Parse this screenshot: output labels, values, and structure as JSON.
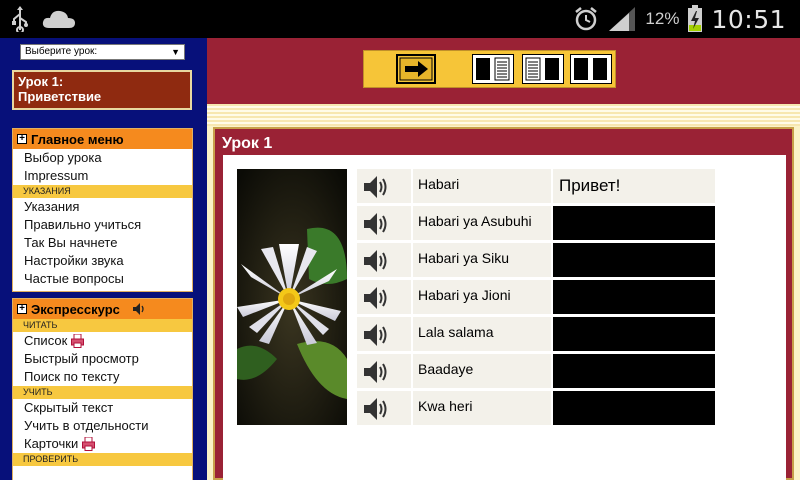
{
  "status_bar": {
    "battery_percent": "12%",
    "time": "10:51",
    "icons": [
      "usb-icon",
      "cloud-icon",
      "alarm-icon",
      "signal-icon",
      "battery-charging-icon"
    ]
  },
  "sidebar": {
    "lesson_select": {
      "value": "Выберите урок:"
    },
    "current_lesson": {
      "line1": "Урок 1:",
      "line2": "Приветствие"
    },
    "main_menu": {
      "title": "Главное меню",
      "items": [
        "Выбор урока",
        "Impressum"
      ],
      "section": "УКАЗАНИЯ",
      "section_items": [
        "Указания",
        "Правильно учиться",
        "Так Вы начнете",
        "Настройки звука",
        "Частые вопросы"
      ]
    },
    "express": {
      "title": "Экспресскурс",
      "read_section": "ЧИТАТЬ",
      "read_items": [
        "Список",
        "Быстрый просмотр",
        "Поиск по тексту"
      ],
      "learn_section": "УЧИТЬ",
      "learn_items": [
        "Скрытый текст",
        "Учить в отдельности",
        "Карточки"
      ],
      "check_section": "ПРОВЕРИТЬ"
    }
  },
  "toolbar": {
    "buttons": [
      "next-arrow-button",
      "layout-text-right-button",
      "layout-text-left-button",
      "layout-two-column-button"
    ]
  },
  "lesson": {
    "title": "Урок 1",
    "phrases": [
      {
        "text": "Habari",
        "translation": "Привет!",
        "revealed": true
      },
      {
        "text": "Habari ya Asubuhi",
        "translation": "",
        "revealed": false
      },
      {
        "text": "Habari ya Siku",
        "translation": "",
        "revealed": false
      },
      {
        "text": "Habari ya Jioni",
        "translation": "",
        "revealed": false
      },
      {
        "text": "Lala salama",
        "translation": "",
        "revealed": false
      },
      {
        "text": "Baadaye",
        "translation": "",
        "revealed": false
      },
      {
        "text": "Kwa heri",
        "translation": "",
        "revealed": false
      }
    ]
  },
  "colors": {
    "sidebar_bg": "#07107a",
    "header_bg": "#9a2235",
    "panel_head": "#f58a1e",
    "panel_sub": "#f7c840",
    "toolbar_bg": "#f6c538"
  }
}
